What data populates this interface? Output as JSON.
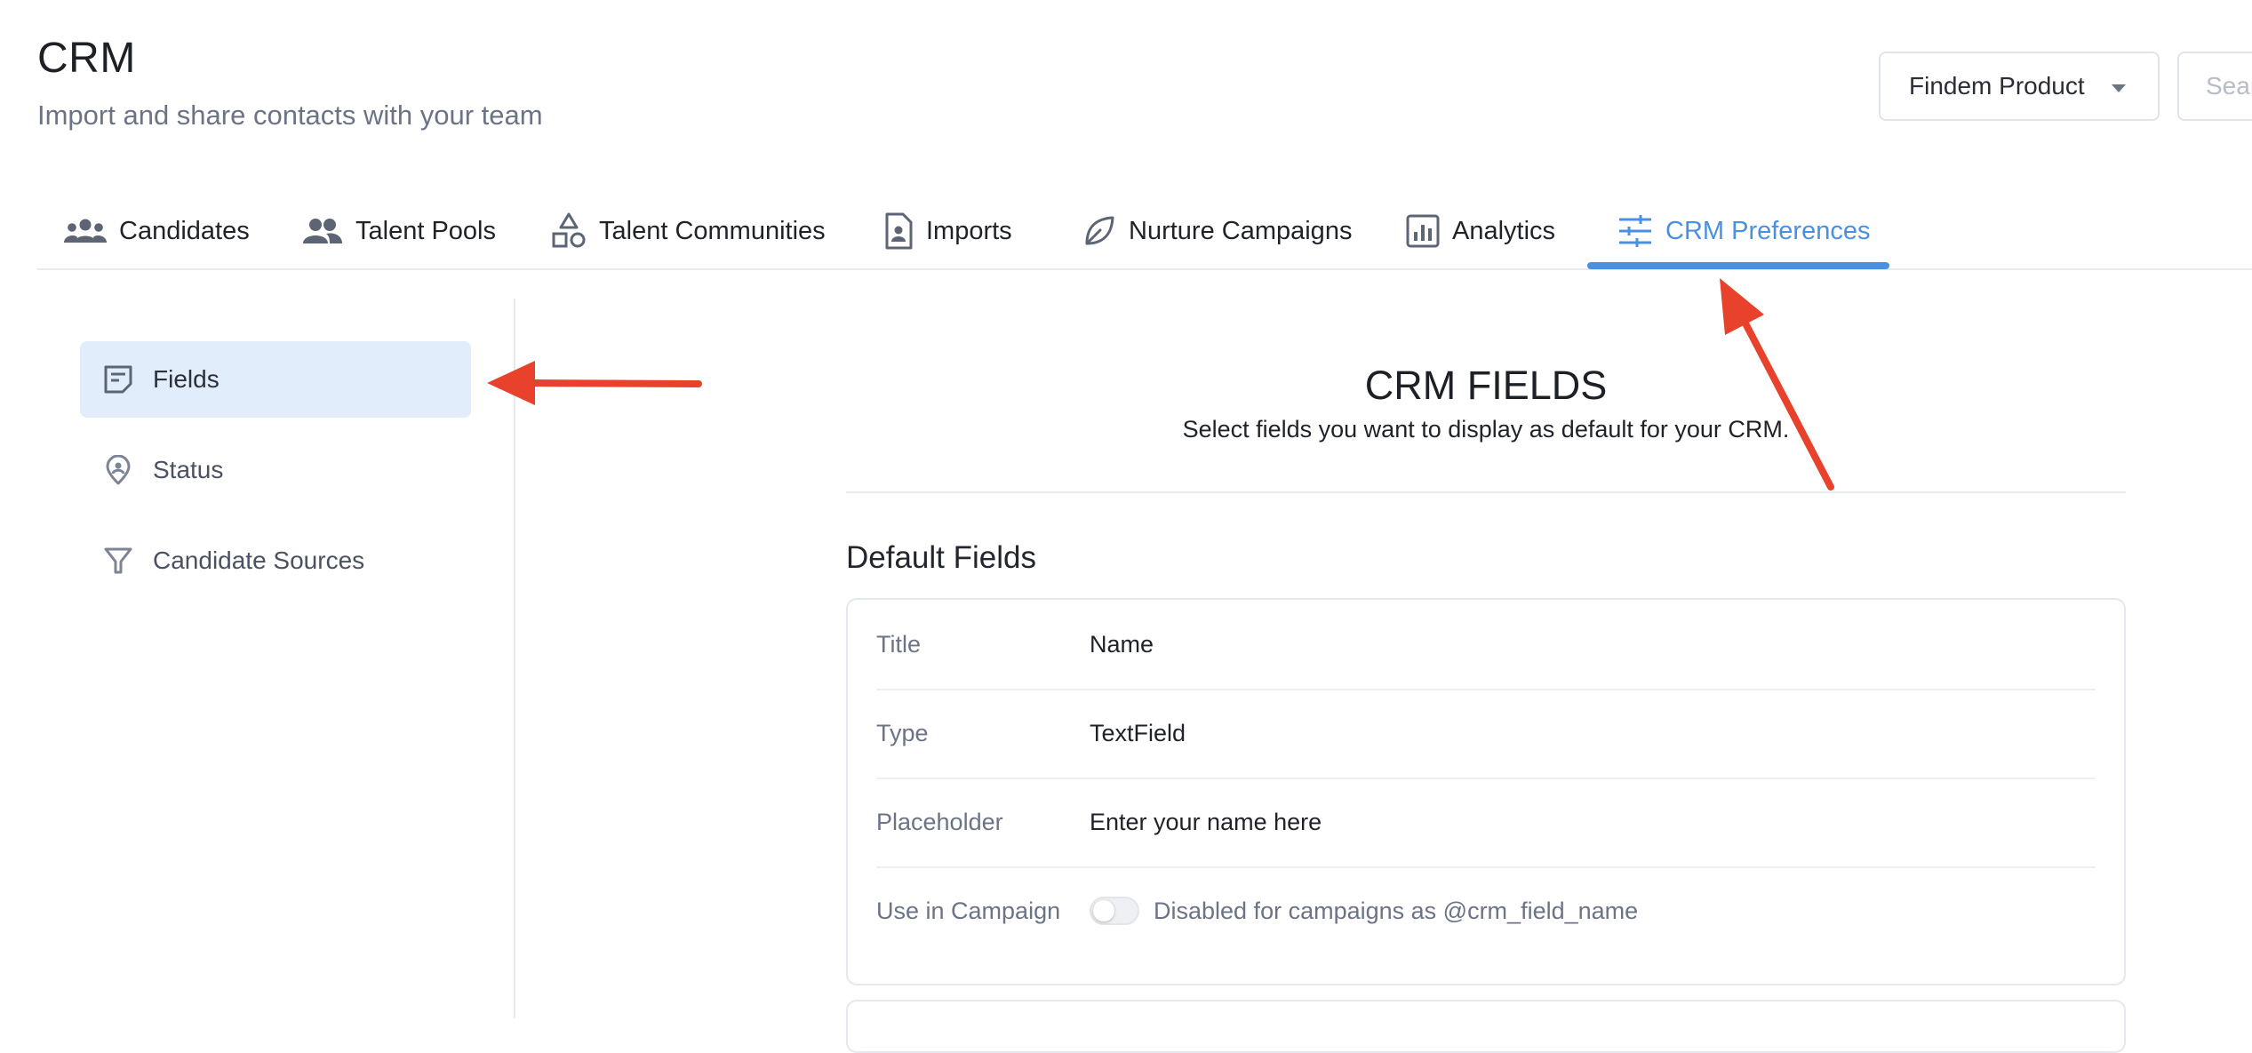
{
  "header": {
    "title": "CRM",
    "subtitle": "Import and share contacts with your team",
    "workspace_select": "Findem Product",
    "search_placeholder": "Search"
  },
  "tabs": [
    {
      "label": "Candidates",
      "icon": "users-group-icon"
    },
    {
      "label": "Talent Pools",
      "icon": "users-icon"
    },
    {
      "label": "Talent Communities",
      "icon": "shapes-icon"
    },
    {
      "label": "Imports",
      "icon": "file-user-icon"
    },
    {
      "label": "Nurture Campaigns",
      "icon": "leaf-icon"
    },
    {
      "label": "Analytics",
      "icon": "bar-chart-icon"
    },
    {
      "label": "CRM Preferences",
      "icon": "sliders-icon",
      "active": true
    }
  ],
  "sidebar": {
    "items": [
      {
        "label": "Fields",
        "icon": "note-icon",
        "active": true
      },
      {
        "label": "Status",
        "icon": "map-pin-icon"
      },
      {
        "label": "Candidate Sources",
        "icon": "filter-icon"
      }
    ]
  },
  "main": {
    "heading": "CRM FIELDS",
    "description": "Select fields you want to display as default for your CRM.",
    "section_title": "Default Fields",
    "field_card": {
      "rows": [
        {
          "key": "Title",
          "value": "Name"
        },
        {
          "key": "Type",
          "value": "TextField"
        },
        {
          "key": "Placeholder",
          "value": "Enter your name here"
        },
        {
          "key": "Use in Campaign",
          "value": "Disabled for campaigns as @crm_field_name"
        }
      ],
      "use_in_campaign_enabled": false
    }
  },
  "colors": {
    "accent": "#4a90e2",
    "annotation_arrow": "#e8412c",
    "active_bg": "#e2edfb"
  }
}
